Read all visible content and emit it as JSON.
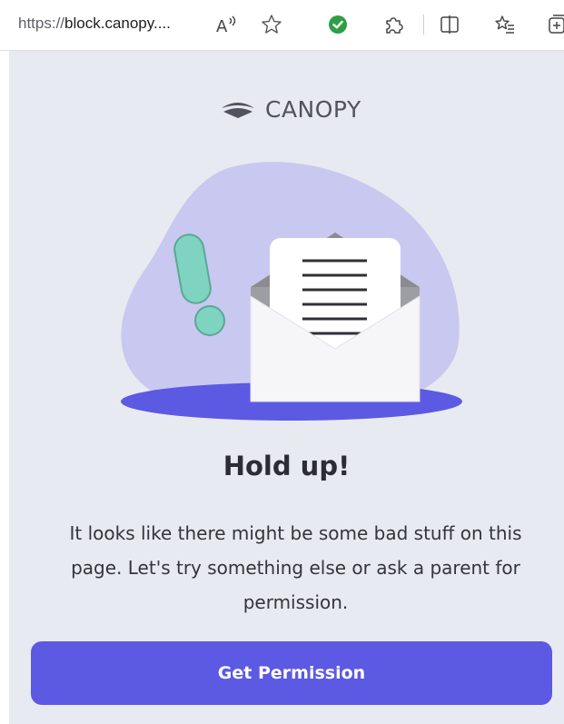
{
  "browser": {
    "url_prefix": "https://",
    "url_host": "block.canopy....",
    "icons": [
      "read-aloud-icon",
      "favorite-star-icon",
      "shield-check-icon",
      "extensions-icon",
      "split-screen-icon",
      "favorites-list-icon",
      "collections-icon"
    ]
  },
  "page": {
    "logo_text": "CANOPY",
    "heading": "Hold up!",
    "message": "It looks like there might be some bad stuff on this page. Let's try something else or ask a parent for permission.",
    "button_label": "Get Permission"
  },
  "colors": {
    "background": "#e8eaf1",
    "accent": "#5c59e3",
    "blob": "#c9c8f0",
    "exclamation": "#7fd3c1",
    "check_green": "#2e9f45"
  }
}
